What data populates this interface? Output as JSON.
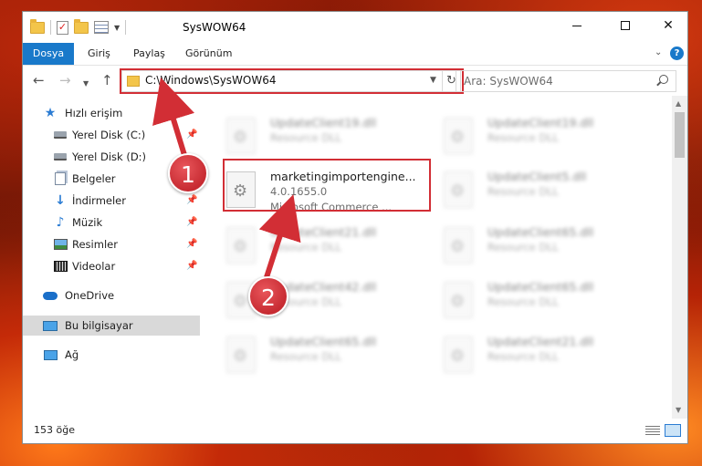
{
  "window": {
    "title": "SysWOW64",
    "controls": {
      "minimize": "",
      "maximize": "",
      "close": "✕"
    }
  },
  "ribbon": {
    "tabs": [
      "Dosya",
      "Giriş",
      "Paylaş",
      "Görünüm"
    ],
    "help": "?"
  },
  "address": {
    "path": "C:\\Windows\\SysWOW64",
    "search_placeholder": "Ara: SysWOW64"
  },
  "sidebar": {
    "items": [
      {
        "label": "Hızlı erişim",
        "icon": "star-icon",
        "pinned": false
      },
      {
        "label": "Yerel Disk (C:)",
        "icon": "drive-icon",
        "pinned": true
      },
      {
        "label": "Yerel Disk (D:)",
        "icon": "drive-icon",
        "pinned": false
      },
      {
        "label": "Belgeler",
        "icon": "documents-icon",
        "pinned": true
      },
      {
        "label": "İndirmeler",
        "icon": "download-icon",
        "pinned": true
      },
      {
        "label": "Müzik",
        "icon": "music-icon",
        "pinned": true
      },
      {
        "label": "Resimler",
        "icon": "pictures-icon",
        "pinned": true
      },
      {
        "label": "Videolar",
        "icon": "videos-icon",
        "pinned": true
      },
      {
        "label": "OneDrive",
        "icon": "onedrive-icon",
        "pinned": false
      },
      {
        "label": "Bu bilgisayar",
        "icon": "this-pc-icon",
        "pinned": false
      },
      {
        "label": "Ağ",
        "icon": "network-icon",
        "pinned": false
      }
    ]
  },
  "files": [
    {
      "name": "UpdateClient19.dll",
      "line2": "Resource DLL",
      "line3": "",
      "blurred": true
    },
    {
      "name": "UpdateClient19.dll",
      "line2": "Resource DLL",
      "line3": "",
      "blurred": true
    },
    {
      "name": "marketingimportengine...",
      "line2": "4.0.1655.0",
      "line3": "Microsoft Commerce ...",
      "blurred": false
    },
    {
      "name": "UpdateClient5.dll",
      "line2": "Resource DLL",
      "line3": "",
      "blurred": true
    },
    {
      "name": "UpdateClient21.dll",
      "line2": "Resource DLL",
      "line3": "",
      "blurred": true
    },
    {
      "name": "UpdateClient65.dll",
      "line2": "Resource DLL",
      "line3": "",
      "blurred": true
    },
    {
      "name": "UpdateClient42.dll",
      "line2": "Resource DLL",
      "line3": "",
      "blurred": true
    },
    {
      "name": "UpdateClient65.dll",
      "line2": "Resource DLL",
      "line3": "",
      "blurred": true
    },
    {
      "name": "UpdateClient65.dll",
      "line2": "Resource DLL",
      "line3": "",
      "blurred": true
    },
    {
      "name": "UpdateClient21.dll",
      "line2": "Resource DLL",
      "line3": "",
      "blurred": true
    }
  ],
  "status": {
    "count": "153 öğe"
  },
  "annotations": {
    "step1": "1",
    "step2": "2",
    "color": "#d22e35"
  }
}
